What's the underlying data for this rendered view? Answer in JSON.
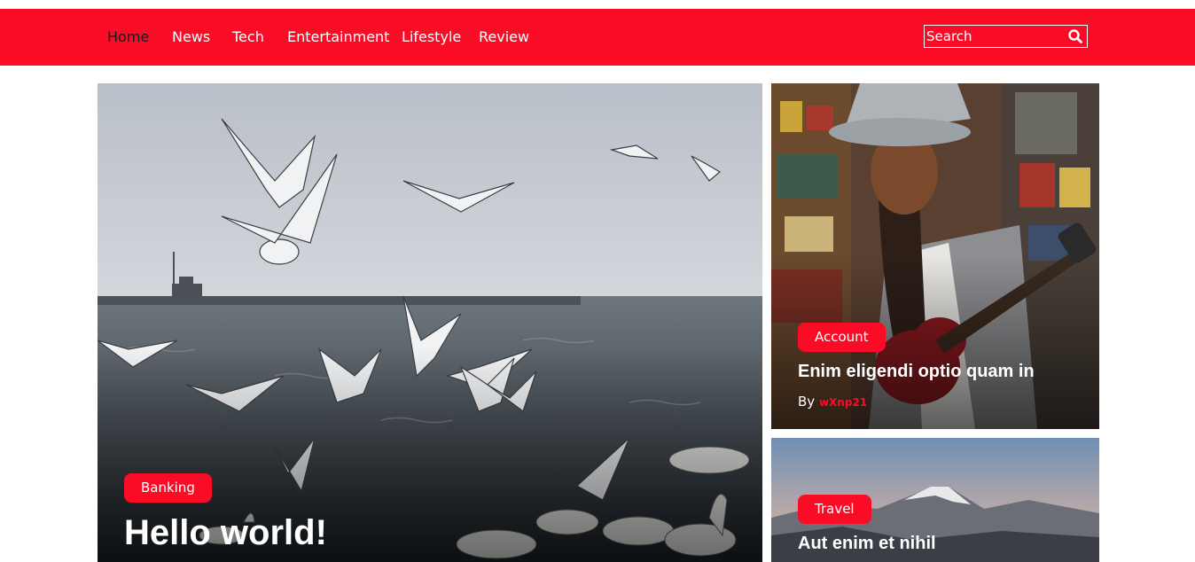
{
  "nav": {
    "items": [
      "Home",
      "News",
      "Tech",
      "Entertainment",
      "Lifestyle",
      "Review"
    ],
    "search_placeholder": "Search"
  },
  "featured": {
    "category": "Banking",
    "title": "Hello world!"
  },
  "side_posts": [
    {
      "category": "Account",
      "title": "Enim eligendi optio quam in",
      "by": "By",
      "author": "wXnp21"
    },
    {
      "category": "Travel",
      "title": "Aut enim et nihil"
    }
  ],
  "colors": {
    "accent": "#fb0c26"
  },
  "icons": {
    "search": "search-icon"
  }
}
